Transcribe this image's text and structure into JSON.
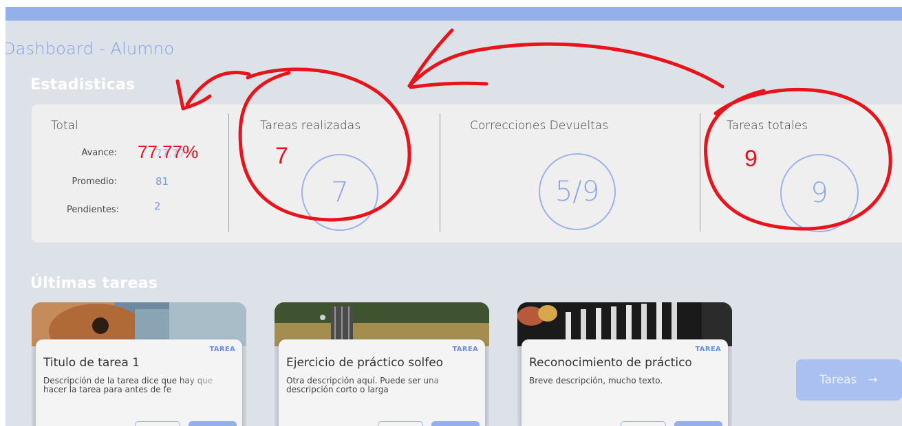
{
  "page": {
    "title": "Dashboard - Alumno"
  },
  "sections": {
    "stats_title": "Estadisticas",
    "tasks_title": "Últimas tareas"
  },
  "stats": {
    "total": {
      "title": "Total",
      "rows": [
        {
          "label": "Avance:",
          "value": "77.77%"
        },
        {
          "label": "Promedio:",
          "value": "81"
        },
        {
          "label": "Pendientes:",
          "value": "2"
        }
      ]
    },
    "realizadas": {
      "title": "Tareas realizadas",
      "value": "7"
    },
    "correcciones": {
      "title": "Correcciones Devueltas",
      "value": "5/9"
    },
    "totales": {
      "title": "Tareas totales",
      "value": "9"
    }
  },
  "annotations": {
    "avance_overlay": "77.77%",
    "realizadas_overlay": "7",
    "totales_overlay": "9",
    "color": "#e8141b"
  },
  "tasks": [
    {
      "tag": "TAREA",
      "title": "Titulo de tarea 1",
      "description": "Descripción de la tarea dice que hay que hacer la tarea para antes de fe",
      "image": "guitar-player-image"
    },
    {
      "tag": "TAREA",
      "title": "Ejercicio de práctico solfeo",
      "description": "Otra descripción aquí. Puede ser una descripción corto o larga",
      "image": "guitar-neck-grass-image"
    },
    {
      "tag": "TAREA",
      "title": "Reconocimiento de práctico",
      "description": "Breve descripción, mucho texto.",
      "image": "guitar-store-image"
    }
  ],
  "tareas_button": {
    "label": "Tareas",
    "icon": "arrow-right-icon"
  },
  "colors": {
    "accent": "#93b0ea",
    "background": "#dde1e8",
    "card": "#efefef",
    "annotation": "#e8141b"
  }
}
